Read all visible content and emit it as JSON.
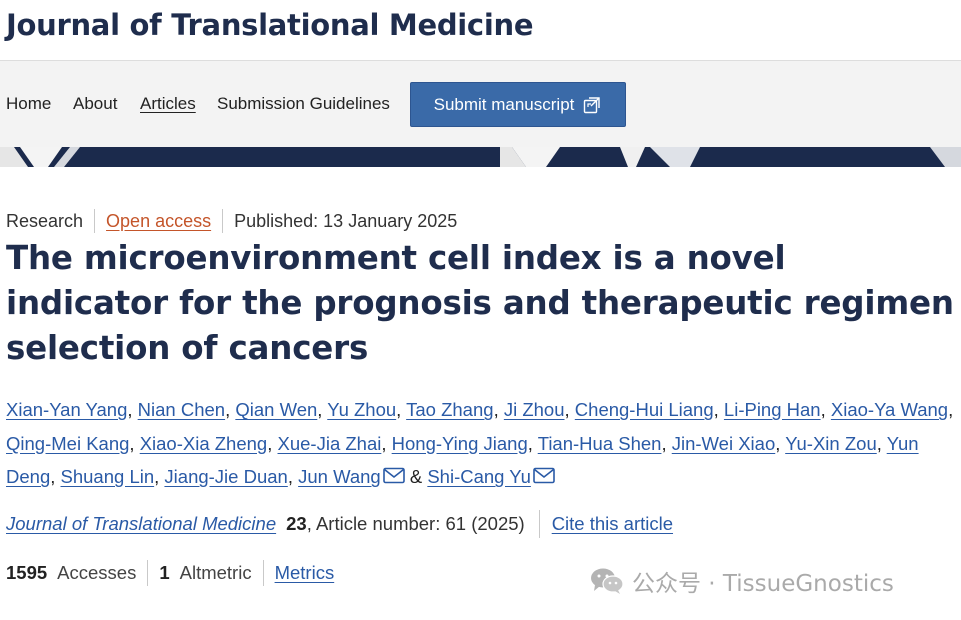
{
  "journal": {
    "title": "Journal of Translational Medicine"
  },
  "nav": {
    "items": [
      {
        "label": "Home",
        "active": false
      },
      {
        "label": "About",
        "active": false
      },
      {
        "label": "Articles",
        "active": true
      },
      {
        "label": "Submission Guidelines",
        "active": false
      }
    ],
    "submit_label": "Submit manuscript",
    "submit_icon": "external-link-icon",
    "accent_color": "#3a6aa8"
  },
  "article": {
    "type": "Research",
    "access": "Open access",
    "published": "Published: 13 January 2025",
    "title": "The microenvironment cell index is a novel indicator for the prognosis and therapeutic regimen selection of cancers",
    "authors": [
      {
        "name": "Xian-Yan Yang",
        "sep": ", "
      },
      {
        "name": "Nian Chen",
        "sep": ", "
      },
      {
        "name": "Qian Wen",
        "sep": ", "
      },
      {
        "name": "Yu Zhou",
        "sep": ", "
      },
      {
        "name": "Tao Zhang",
        "sep": ", "
      },
      {
        "name": "Ji Zhou",
        "sep": ", "
      },
      {
        "name": "Cheng-Hui Liang",
        "sep": ", "
      },
      {
        "name": "Li-Ping Han",
        "sep": ", "
      },
      {
        "name": "Xiao-Ya Wang",
        "sep": ", "
      },
      {
        "name": "Qing-Mei Kang",
        "sep": ", "
      },
      {
        "name": "Xiao-Xia Zheng",
        "sep": ", "
      },
      {
        "name": "Xue-Jia Zhai",
        "sep": ", "
      },
      {
        "name": "Hong-Ying Jiang",
        "sep": ", "
      },
      {
        "name": "Tian-Hua Shen",
        "sep": ", "
      },
      {
        "name": "Jin-Wei Xiao",
        "sep": ", "
      },
      {
        "name": "Yu-Xin Zou",
        "sep": ", "
      },
      {
        "name": "Yun Deng",
        "sep": ", "
      },
      {
        "name": "Shuang Lin",
        "sep": ", "
      },
      {
        "name": "Jiang-Jie Duan",
        "sep": ", "
      },
      {
        "name": "Jun Wang",
        "sep": " & ",
        "corresponding": true
      },
      {
        "name": "Shi-Cang Yu",
        "sep": "",
        "corresponding": true
      }
    ],
    "citation": {
      "journal": "Journal of Translational Medicine",
      "volume": "23",
      "article_number": ", Article number: 61 (2025)",
      "cite_label": "Cite this article"
    },
    "metrics": {
      "accesses_count": "1595",
      "accesses_label": "Accesses",
      "altmetric_count": "1",
      "altmetric_label": "Altmetric",
      "metrics_label": "Metrics"
    }
  },
  "watermark": {
    "text": "公众号 · TissueGnostics",
    "icon": "wechat-icon"
  }
}
